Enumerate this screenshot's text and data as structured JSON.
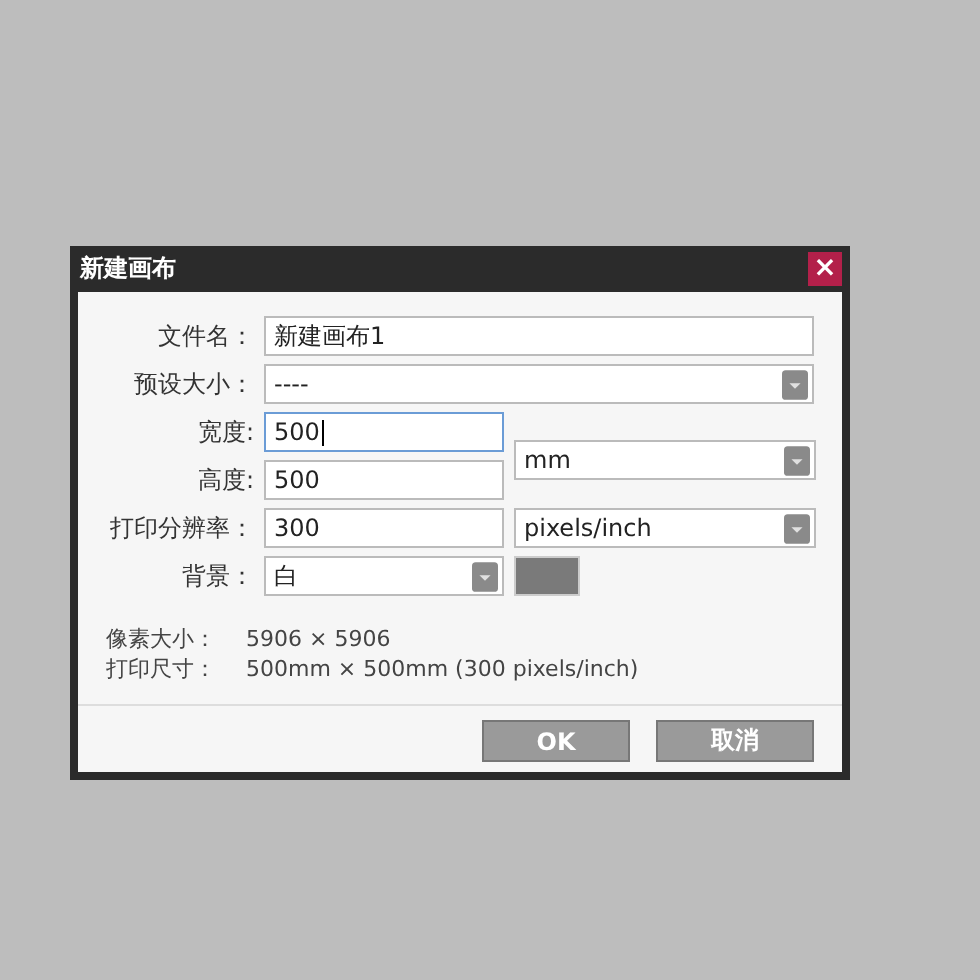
{
  "dialog": {
    "title": "新建画布",
    "close": "×"
  },
  "fields": {
    "filename": {
      "label": "文件名：",
      "value": "新建画布1"
    },
    "preset": {
      "label": "预设大小：",
      "value": "----"
    },
    "width": {
      "label": "宽度:",
      "value": "500",
      "focused": true
    },
    "height": {
      "label": "高度:",
      "value": "500",
      "focused": false
    },
    "unit": {
      "value": "mm"
    },
    "resolution": {
      "label": "打印分辨率：",
      "value": "300"
    },
    "resolution_unit": {
      "value": "pixels/inch"
    },
    "background": {
      "label": "背景：",
      "value": "白"
    }
  },
  "info": [
    {
      "label": "像素大小：",
      "value": "5906 × 5906"
    },
    {
      "label": "打印尺寸：",
      "value": "500mm × 500mm (300 pixels/inch)"
    }
  ],
  "buttons": [
    {
      "label": "OK"
    },
    {
      "label": "取消"
    }
  ]
}
